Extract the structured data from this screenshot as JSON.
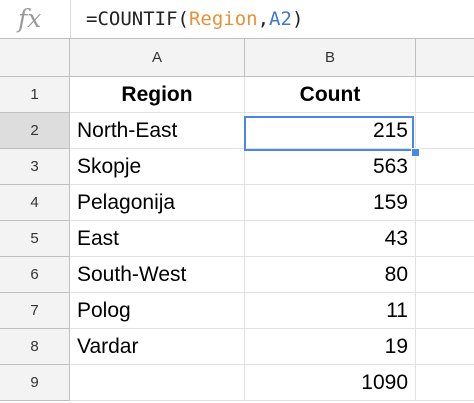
{
  "formula_bar": {
    "fx_label": "fx",
    "formula_prefix": "=COUNTIF(",
    "formula_ref1": "Region",
    "formula_sep": ",",
    "formula_ref2": "A2",
    "formula_suffix": ")"
  },
  "columns": [
    "A",
    "B"
  ],
  "rows": [
    {
      "num": "1",
      "a": "Region",
      "b": "Count"
    },
    {
      "num": "2",
      "a": "North-East",
      "b": "215"
    },
    {
      "num": "3",
      "a": "Skopje",
      "b": "563"
    },
    {
      "num": "4",
      "a": "Pelagonija",
      "b": "159"
    },
    {
      "num": "5",
      "a": "East",
      "b": "43"
    },
    {
      "num": "6",
      "a": "South-West",
      "b": "80"
    },
    {
      "num": "7",
      "a": "Polog",
      "b": "11"
    },
    {
      "num": "8",
      "a": "Vardar",
      "b": "19"
    },
    {
      "num": "9",
      "a": "",
      "b": "1090"
    }
  ],
  "colors": {
    "selection": "#4a86e8",
    "formula_ref1": "#e69138",
    "formula_ref2": "#3c78d8"
  }
}
